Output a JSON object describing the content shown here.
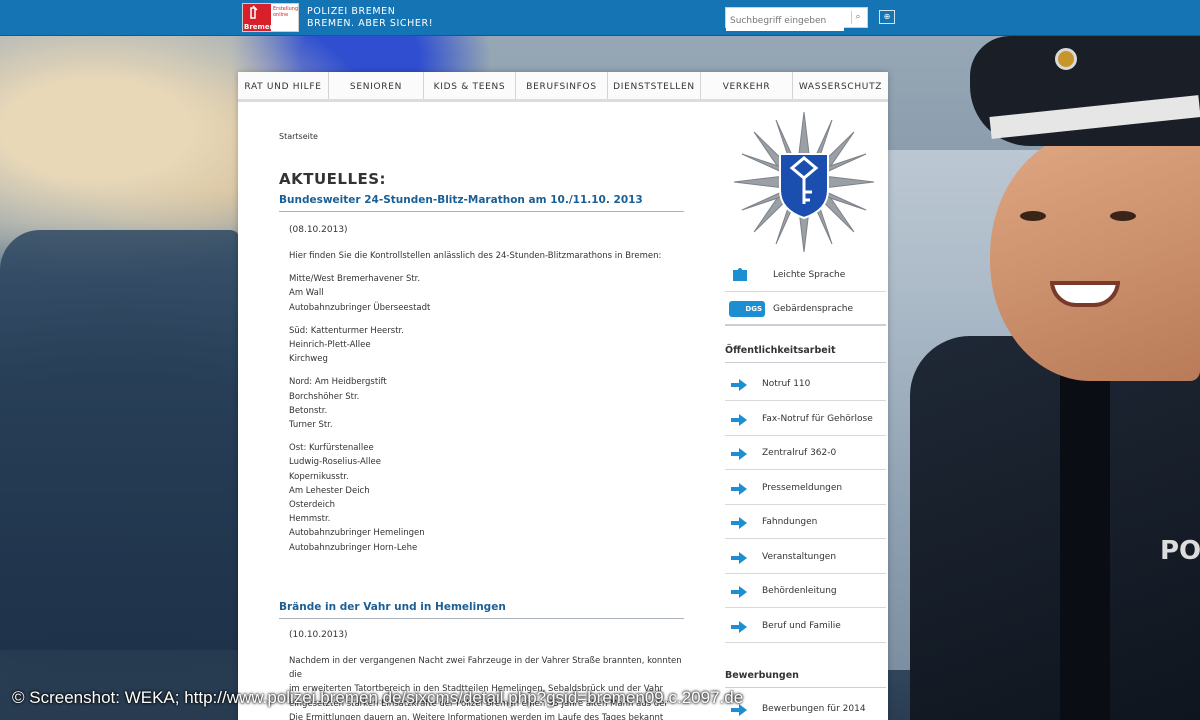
{
  "header": {
    "logo_text": "Bremen",
    "logo_small": "Erstellung online",
    "brand_line1": "POLIZEI BREMEN",
    "brand_line2": "BREMEN. ABER SICHER!",
    "search_placeholder": "Suchbegriff eingeben"
  },
  "nav": [
    "RAT UND HILFE",
    "SENIOREN",
    "KIDS & TEENS",
    "BERUFSINFOS",
    "DIENSTSTELLEN",
    "VERKEHR",
    "WASSERSCHUTZ"
  ],
  "breadcrumb": "Startseite",
  "heading": "AKTUELLES:",
  "article1": {
    "title": "Bundesweiter 24-Stunden-Blitz-Marathon am 10./11.10. 2013",
    "date": "(08.10.2013)",
    "intro": "Hier finden Sie die Kontrollstellen anlässlich des 24-Stunden-Blitzmarathons in Bremen:",
    "blocks": [
      [
        "Mitte/West Bremerhavener Str.",
        "Am Wall",
        "Autobahnzubringer Überseestadt"
      ],
      [
        "Süd: Kattenturmer Heerstr.",
        "Heinrich-Plett-Allee",
        "Kirchweg"
      ],
      [
        "Nord: Am Heidbergstift",
        "Borchshöher Str.",
        "Betonstr.",
        "Turner Str."
      ],
      [
        "Ost: Kurfürstenallee",
        "Ludwig-Roselius-Allee",
        "Kopernikusstr.",
        "Am Lehester Deich",
        "Osterdeich",
        "Hemmstr.",
        "Autobahnzubringer Hemelingen",
        "Autobahnzubringer Horn-Lehe"
      ]
    ]
  },
  "article2": {
    "title": "Brände in der Vahr und in Hemelingen",
    "date": "(10.10.2013)",
    "lines": [
      "Nachdem in der vergangenen Nacht zwei Fahrzeuge in der Vahrer Straße brannten, konnten die",
      "im erweiterten Tatortbereich in den Stadtteilen Hemelingen, Sebaldsbrück und der Vahr",
      "eingesetzten starken Einsatzkräfte der Polizei Bremen einen 33 Jahre alten Mann aus der",
      "Die Ermittlungen dauern an. Weitere Informationen werden im Laufe des Tages bekannt"
    ]
  },
  "sidebar": {
    "easy_language": "Leichte Sprache",
    "sign_language": "Gebärdensprache",
    "dgs_label": "DGS",
    "section1": "Öffentlichkeitsarbeit",
    "links": [
      "Notruf 110",
      "Fax-Notruf für Gehörlose",
      "Zentralruf 362-0",
      "Pressemeldungen",
      "Fahndungen",
      "Veranstaltungen",
      "Behördenleitung",
      "Beruf und Familie"
    ],
    "section2": "Bewerbungen",
    "partial_link": "Bewerbungen für 2014"
  },
  "caption": "© Screenshot: WEKA; http://www.polizei.bremen.de/sixcms/detail.php?gsid=bremen09.c.2097.de",
  "officer_text": "PO",
  "colors": {
    "topbar": "#1574b4",
    "link": "#1a5f96",
    "arrow": "#1b8fd1"
  }
}
